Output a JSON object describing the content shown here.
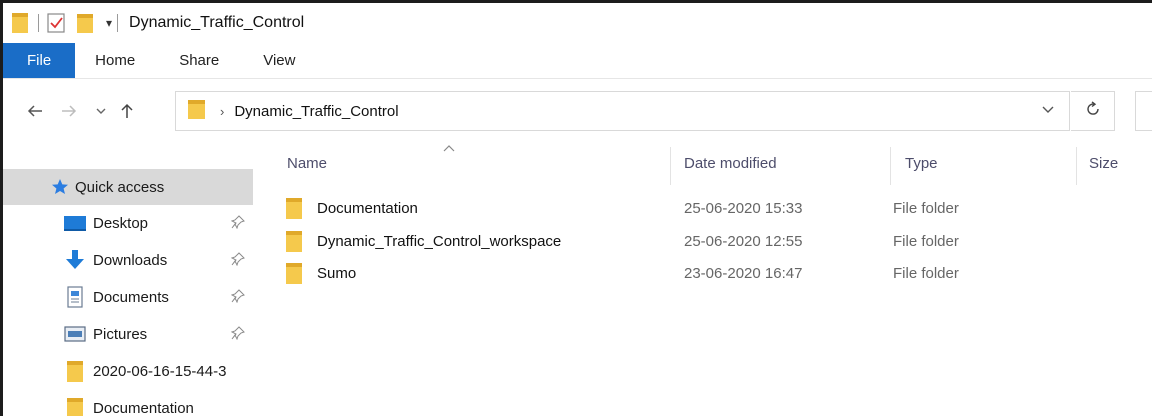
{
  "window": {
    "title": "Dynamic_Traffic_Control"
  },
  "ribbon": {
    "tabs": [
      {
        "label": "File"
      },
      {
        "label": "Home"
      },
      {
        "label": "Share"
      },
      {
        "label": "View"
      }
    ]
  },
  "address": {
    "crumb": "Dynamic_Traffic_Control"
  },
  "nav_pane": {
    "items": [
      {
        "label": "Quick access",
        "icon": "star-icon"
      },
      {
        "label": "Desktop",
        "icon": "desktop-icon",
        "pinned": true
      },
      {
        "label": "Downloads",
        "icon": "download-icon",
        "pinned": true
      },
      {
        "label": "Documents",
        "icon": "documents-icon",
        "pinned": true
      },
      {
        "label": "Pictures",
        "icon": "pictures-icon",
        "pinned": true
      },
      {
        "label": "2020-06-16-15-44-3",
        "icon": "folder-icon"
      },
      {
        "label": "Documentation",
        "icon": "folder-icon"
      }
    ]
  },
  "columns": {
    "name": "Name",
    "date": "Date modified",
    "type": "Type",
    "size": "Size"
  },
  "files": [
    {
      "name": "Documentation",
      "date": "25-06-2020 15:33",
      "type": "File folder"
    },
    {
      "name": "Dynamic_Traffic_Control_workspace",
      "date": "25-06-2020 12:55",
      "type": "File folder"
    },
    {
      "name": "Sumo",
      "date": "23-06-2020 16:47",
      "type": "File folder"
    }
  ],
  "colors": {
    "accent": "#1a6dc7",
    "folder": "#f5c94c",
    "folder_dark": "#e0a92a",
    "selection": "#d9d9d9"
  }
}
